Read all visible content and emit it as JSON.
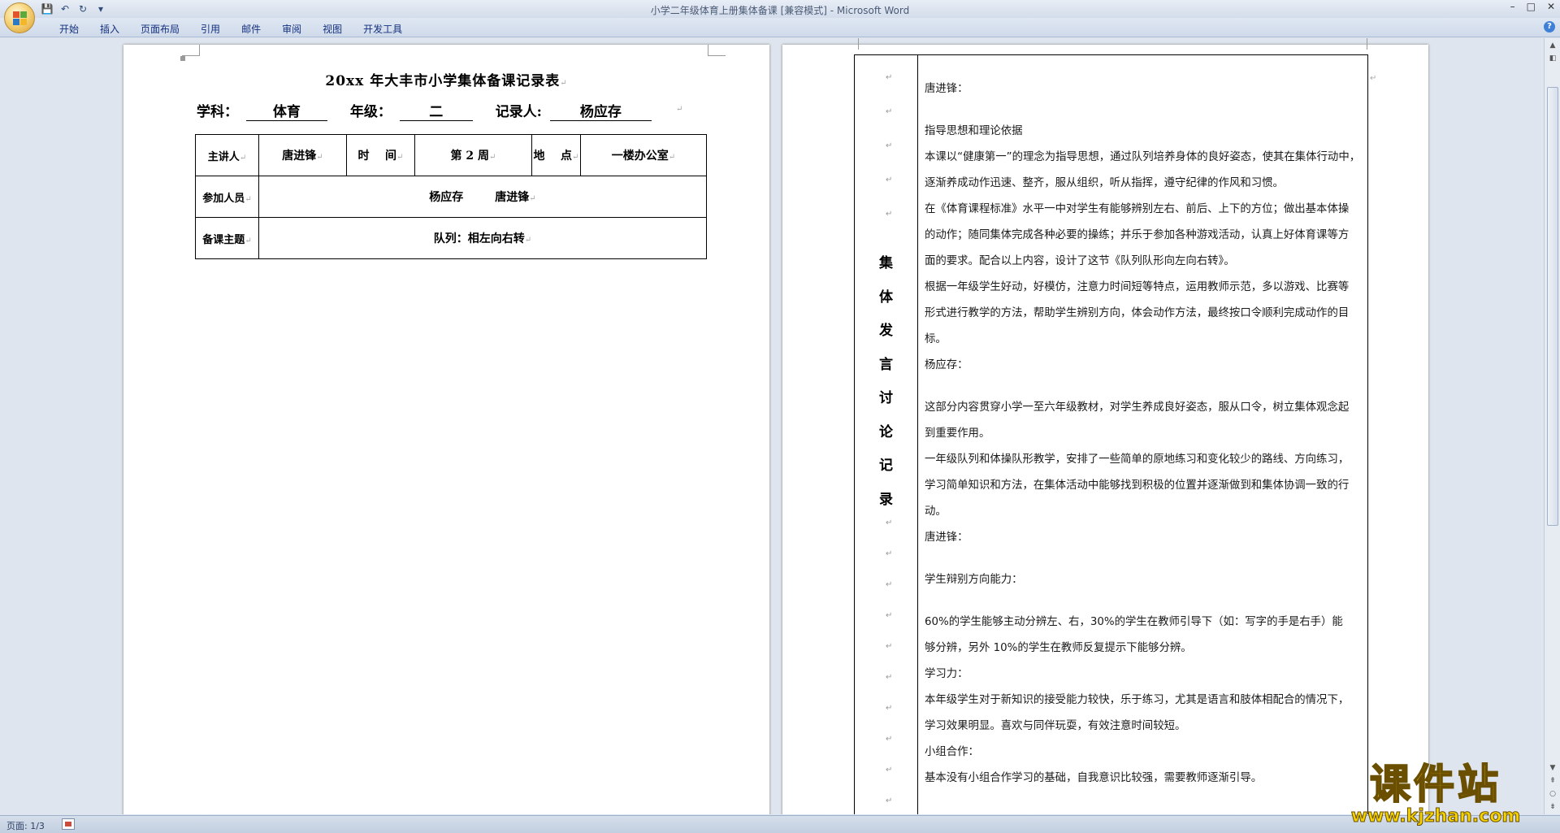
{
  "window": {
    "title": "小学二年级体育上册集体备课 [兼容模式] - Microsoft Word",
    "controls": [
      "–",
      "□",
      "✕"
    ]
  },
  "ribbon": {
    "tabs": [
      "开始",
      "插入",
      "页面布局",
      "引用",
      "邮件",
      "审阅",
      "视图",
      "开发工具"
    ],
    "help": "?"
  },
  "page1": {
    "title": "20xx 年大丰市小学集体备课记录表",
    "subject_label": "学科：",
    "subject_value": "体育",
    "grade_label": "年级：",
    "grade_value": "二",
    "recorder_label": "记录人:",
    "recorder_value": "杨应存",
    "table": {
      "speaker_label": "主讲人",
      "speaker_value": "唐进锋",
      "time_label": "时    间",
      "time_value": "第 2 周",
      "place_label": "地    点",
      "place_value": "一楼办公室",
      "participants_label": "参加人员",
      "participants_value": "杨应存        唐进锋",
      "topic_label": "备课主题",
      "topic_value": "队列：相左向右转"
    }
  },
  "page2": {
    "vertical_heading": [
      "集",
      "体",
      "发",
      "言",
      "讨",
      "论",
      "记",
      "录"
    ],
    "paragraphs": [
      [
        "唐进锋："
      ],
      [
        "指导思想和理论依据"
      ],
      [
        "本课以“健康第一”的理念为指导思想，通过队列培养身体的良好姿态，使其在集体行动中，",
        "逐渐养成动作迅速、整齐，服从组织，听从指挥，遵守纪律的作风和习惯。"
      ],
      [
        "在《体育课程标准》水平一中对学生有能够辨别左右、前后、上下的方位；做出基本体操",
        "的动作；随同集体完成各种必要的操练；并乐于参加各种游戏活动，认真上好体育课等方",
        "面的要求。配合以上内容，设计了这节《队列队形向左向右转》。"
      ],
      [
        "根据一年级学生好动，好模仿，注意力时间短等特点，运用教师示范，多以游戏、比赛等",
        "形式进行教学的方法，帮助学生辨别方向，体会动作方法，最终按口令顺利完成动作的目",
        "标。"
      ],
      [
        "杨应存："
      ],
      [
        "这部分内容贯穿小学一至六年级教材，对学生养成良好姿态，服从口令，树立集体观念起",
        "到重要作用。"
      ],
      [
        "一年级队列和体操队形教学，安排了一些简单的原地练习和变化较少的路线、方向练习，",
        "学习简单知识和方法，在集体活动中能够找到积极的位置并逐渐做到和集体协调一致的行",
        "动。"
      ],
      [
        "唐进锋："
      ],
      [
        "学生辩别方向能力："
      ],
      [
        "60%的学生能够主动分辨左、右，30%的学生在教师引导下（如：写字的手是右手）能",
        "够分辨，另外 10%的学生在教师反复提示下能够分辨。"
      ],
      [
        "学习力："
      ],
      [
        "本年级学生对于新知识的接受能力较快，乐于练习，尤其是语言和肢体相配合的情况下，",
        "学习效果明显。喜欢与同伴玩耍，有效注意时间较短。"
      ],
      [
        "小组合作："
      ],
      [
        "基本没有小组合作学习的基础，自我意识比较强，需要教师逐渐引导。"
      ]
    ]
  },
  "statusbar": {
    "page_info": "页面: 1/3"
  },
  "watermark": {
    "text": "课件站",
    "url": "www.kjzhan.com"
  },
  "colors": {
    "ribbon_bg": "#dfe7f3",
    "workspace_bg": "#dfe5ee",
    "watermark_yellow": "#f5d300"
  }
}
